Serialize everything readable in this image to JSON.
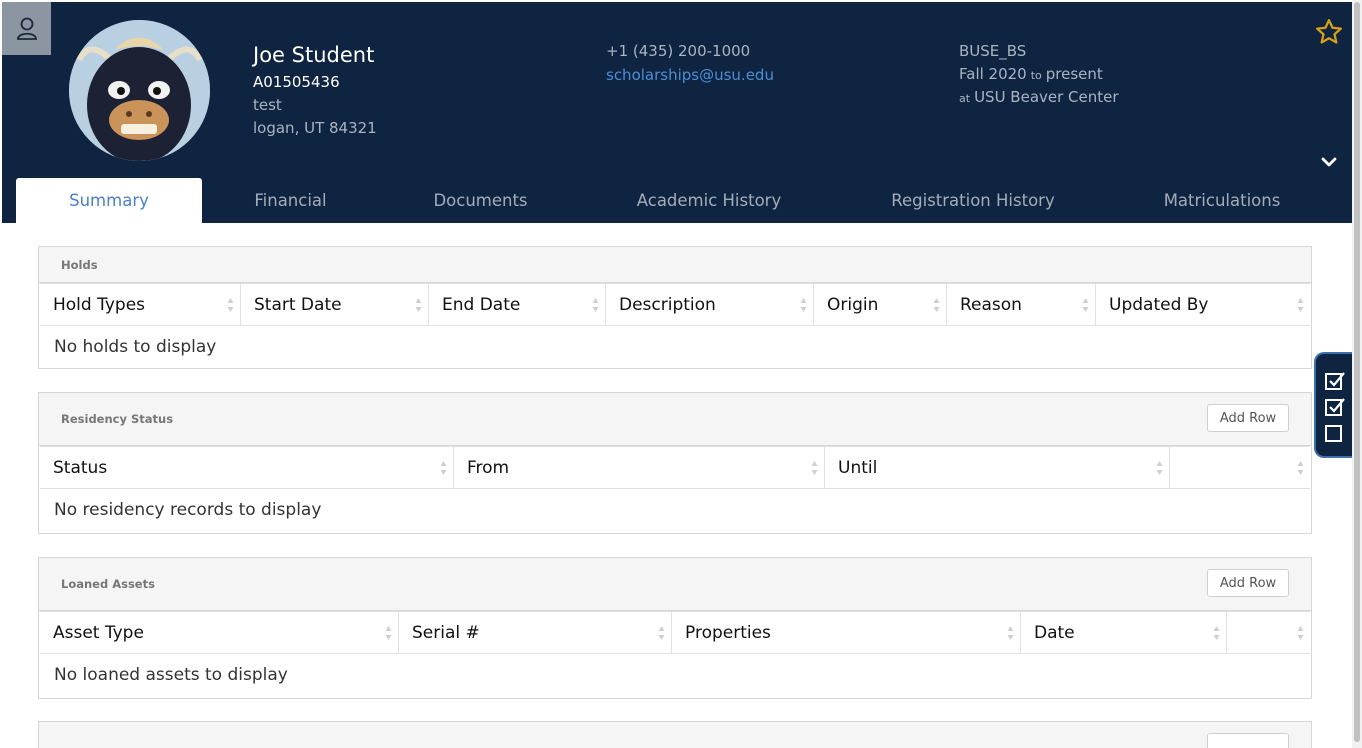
{
  "header": {
    "name": "Joe Student",
    "student_id": "A01505436",
    "address_line1": "test",
    "address_line2": "logan, UT 84321",
    "phone": "+1 (435) 200-1000",
    "email": "scholarships@usu.edu",
    "program": "BUSE_BS",
    "term_start": "Fall 2020",
    "to_word": "to",
    "term_end": "present",
    "at_word": "at",
    "campus": "USU Beaver Center",
    "icons": {
      "user": "user-icon",
      "star": "star-icon",
      "chevron": "chevron-down-icon"
    },
    "colors": {
      "header_bg": "#0f2440",
      "accent": "#4a7fcb",
      "star": "#d4a017"
    }
  },
  "tabs": [
    {
      "label": "Summary",
      "active": true
    },
    {
      "label": "Financial"
    },
    {
      "label": "Documents"
    },
    {
      "label": "Academic History"
    },
    {
      "label": "Registration History"
    },
    {
      "label": "Matriculations"
    }
  ],
  "holds": {
    "title": "Holds",
    "columns": [
      "Hold Types",
      "Start Date",
      "End Date",
      "Description",
      "Origin",
      "Reason",
      "Updated By"
    ],
    "empty_text": "No holds to display"
  },
  "residency": {
    "title": "Residency Status",
    "add_label": "Add Row",
    "columns": [
      "Status",
      "From",
      "Until",
      ""
    ],
    "empty_text": "No residency records to display"
  },
  "assets": {
    "title": "Loaned Assets",
    "add_label": "Add Row",
    "columns": [
      "Asset Type",
      "Serial #",
      "Properties",
      "Date",
      ""
    ],
    "empty_text": "No loaned assets to display"
  }
}
